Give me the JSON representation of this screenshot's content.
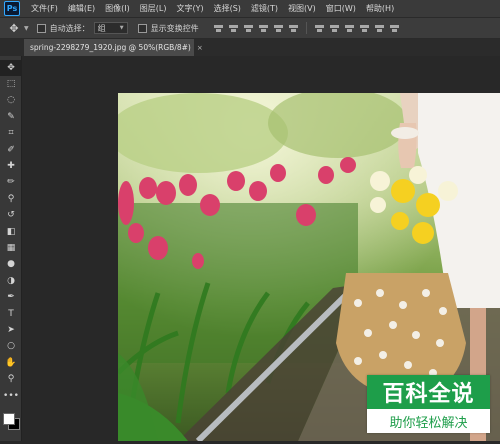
{
  "app": {
    "logo": "Ps"
  },
  "menu": [
    {
      "label": "文件(F)"
    },
    {
      "label": "编辑(E)"
    },
    {
      "label": "图像(I)"
    },
    {
      "label": "图层(L)"
    },
    {
      "label": "文字(Y)"
    },
    {
      "label": "选择(S)"
    },
    {
      "label": "滤镜(T)"
    },
    {
      "label": "视图(V)"
    },
    {
      "label": "窗口(W)"
    },
    {
      "label": "帮助(H)"
    }
  ],
  "options": {
    "move_icon": "move-icon",
    "auto_select_label": "自动选择：",
    "auto_select_value": "组",
    "show_transform_label": "显示变换控件"
  },
  "document": {
    "tab_title": "spring-2298279_1920.jpg @ 50%(RGB/8#)",
    "close": "×"
  },
  "tools": [
    {
      "name": "move-tool",
      "glyph": "✥",
      "active": true
    },
    {
      "name": "marquee-tool",
      "glyph": "⬚"
    },
    {
      "name": "lasso-tool",
      "glyph": "◌"
    },
    {
      "name": "quick-select-tool",
      "glyph": "✎"
    },
    {
      "name": "crop-tool",
      "glyph": "⌗"
    },
    {
      "name": "eyedropper-tool",
      "glyph": "✐"
    },
    {
      "name": "healing-brush-tool",
      "glyph": "✚"
    },
    {
      "name": "brush-tool",
      "glyph": "✏"
    },
    {
      "name": "clone-stamp-tool",
      "glyph": "⚲"
    },
    {
      "name": "history-brush-tool",
      "glyph": "↺"
    },
    {
      "name": "eraser-tool",
      "glyph": "◧"
    },
    {
      "name": "gradient-tool",
      "glyph": "▦"
    },
    {
      "name": "blur-tool",
      "glyph": "●"
    },
    {
      "name": "dodge-tool",
      "glyph": "◑"
    },
    {
      "name": "pen-tool",
      "glyph": "✒"
    },
    {
      "name": "type-tool",
      "glyph": "T"
    },
    {
      "name": "path-select-tool",
      "glyph": "➤"
    },
    {
      "name": "shape-tool",
      "glyph": "○"
    },
    {
      "name": "hand-tool",
      "glyph": "✋"
    },
    {
      "name": "zoom-tool",
      "glyph": "⚲"
    },
    {
      "name": "more-tools",
      "glyph": "•••"
    }
  ],
  "colors": {
    "foreground": "#ffffff",
    "background": "#000000"
  },
  "watermark": {
    "title": "百科全说",
    "subtitle": "助你轻松解决"
  }
}
